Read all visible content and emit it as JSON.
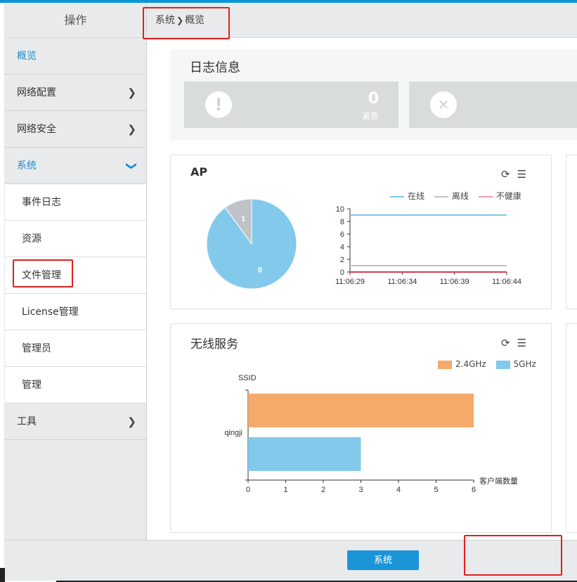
{
  "sidebar": {
    "header": "操作",
    "items": [
      {
        "label": "概览"
      },
      {
        "label": "网络配置"
      },
      {
        "label": "网络安全"
      },
      {
        "label": "系统"
      },
      {
        "label": "工具"
      }
    ],
    "sub_items": [
      {
        "label": "事件日志"
      },
      {
        "label": "资源"
      },
      {
        "label": "文件管理"
      },
      {
        "label": "License管理"
      },
      {
        "label": "管理员"
      },
      {
        "label": "管理"
      }
    ]
  },
  "breadcrumb": {
    "parent": "系统",
    "separator": "❯",
    "current": "概览"
  },
  "log_panel": {
    "title": "日志信息",
    "cards": [
      {
        "icon": "alert-icon",
        "count": "0",
        "label": "紧急"
      },
      {
        "icon": "close-icon",
        "count": "",
        "label": ""
      }
    ]
  },
  "ap_panel": {
    "title": "AP",
    "icons": [
      "refresh-icon",
      "list-icon"
    ],
    "legend": [
      {
        "label": "在线",
        "color": "#7ec8ea"
      },
      {
        "label": "离线",
        "color": "#c0c4c8"
      },
      {
        "label": "不健康",
        "color": "#e8a0a8"
      }
    ]
  },
  "wireless_panel": {
    "title": "无线服务",
    "icons": [
      "refresh-icon",
      "list-icon"
    ],
    "legend": [
      {
        "label": "2.4GHz",
        "color": "#f5a96a"
      },
      {
        "label": "5GHz",
        "color": "#82c9ec"
      }
    ],
    "y_axis_title": "SSID",
    "x_axis_title": "客户端数量"
  },
  "chart_data": [
    {
      "type": "pie",
      "categories": [
        "在线",
        "离线"
      ],
      "values": [
        9,
        1
      ],
      "colors": [
        "#82c9ec",
        "#bfc3c7"
      ]
    },
    {
      "type": "line",
      "x": [
        "11:06:29",
        "11:06:34",
        "11:06:39",
        "11:06:44"
      ],
      "ylim": [
        0,
        10
      ],
      "yticks": [
        0,
        2,
        4,
        6,
        8,
        10
      ],
      "series": [
        {
          "name": "在线",
          "values": [
            9,
            9,
            9,
            9
          ],
          "color": "#7ec8ea"
        },
        {
          "name": "离线",
          "values": [
            1,
            1,
            1,
            1
          ],
          "color": "#c0c4c8"
        },
        {
          "name": "不健康",
          "values": [
            0,
            0,
            0,
            0
          ],
          "color": "#d04050"
        }
      ]
    },
    {
      "type": "bar",
      "orientation": "horizontal",
      "categories": [
        "qingji"
      ],
      "xlim": [
        0,
        6
      ],
      "xticks": [
        0,
        1,
        2,
        3,
        4,
        5,
        6
      ],
      "series": [
        {
          "name": "2.4GHz",
          "values": [
            6
          ],
          "color": "#f5a96a"
        },
        {
          "name": "5GHz",
          "values": [
            3
          ],
          "color": "#82c9ec"
        }
      ],
      "ylabel": "SSID",
      "xlabel": "客户端数量"
    }
  ],
  "footer": {
    "system_button": "系统"
  }
}
